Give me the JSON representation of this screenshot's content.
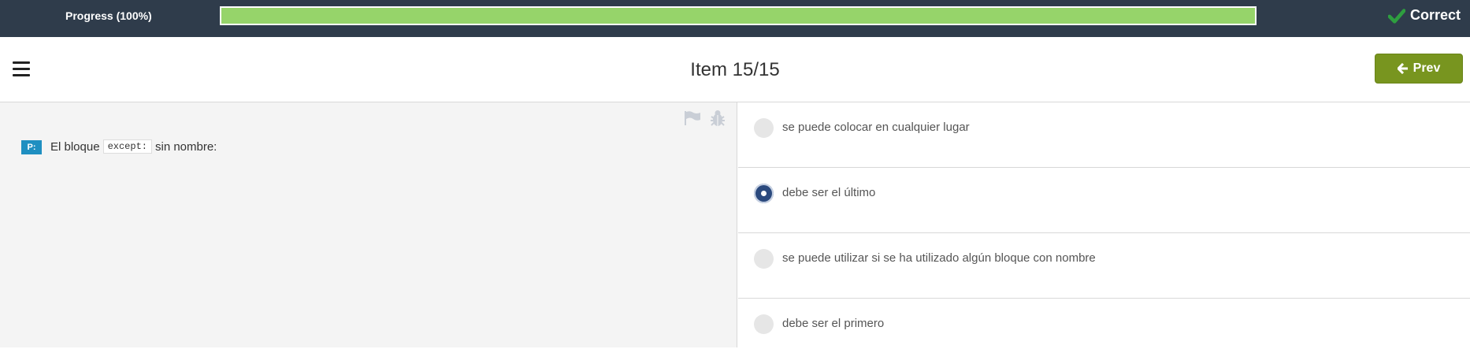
{
  "progress": {
    "label": "Progress (100%)",
    "value_percent": 100,
    "fill_color": "#96d46a"
  },
  "status": {
    "label": "Correct",
    "icon": "check-icon",
    "icon_color": "#2e9e3f"
  },
  "header": {
    "title": "Item 15/15",
    "prev_label": "Prev",
    "prev_icon": "arrow-left-icon",
    "menu_icon": "hamburger-menu-icon"
  },
  "question": {
    "badge": "P:",
    "text_before": "El bloque",
    "code": "except:",
    "text_after": "sin nombre:"
  },
  "tools": {
    "flag_icon": "flag-icon",
    "bug_icon": "bug-icon"
  },
  "options": [
    {
      "label": "se puede colocar en cualquier lugar",
      "selected": false
    },
    {
      "label": "debe ser el último",
      "selected": true
    },
    {
      "label": "se puede utilizar si se ha utilizado algún bloque con nombre",
      "selected": false
    },
    {
      "label": "debe ser el primero",
      "selected": false
    }
  ],
  "colors": {
    "topbar": "#2f3c4b",
    "prev_button": "#78951f",
    "badge": "#1f8fc1",
    "radio_selected": "#2b4a7e"
  }
}
